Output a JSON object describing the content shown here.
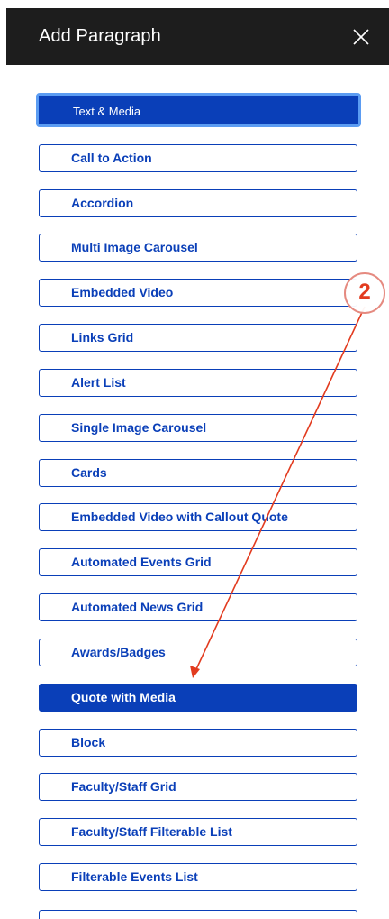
{
  "dialog": {
    "title": "Add Paragraph",
    "close_icon": "close-icon"
  },
  "paragraph_types": [
    {
      "label": "Text & Media",
      "state": "focused"
    },
    {
      "label": "Call to Action",
      "state": "default"
    },
    {
      "label": "Accordion",
      "state": "default"
    },
    {
      "label": "Multi Image Carousel",
      "state": "default"
    },
    {
      "label": "Embedded Video",
      "state": "default"
    },
    {
      "label": "Links Grid",
      "state": "default"
    },
    {
      "label": "Alert List",
      "state": "default"
    },
    {
      "label": "Single Image Carousel",
      "state": "default"
    },
    {
      "label": "Cards",
      "state": "default"
    },
    {
      "label": "Embedded Video with Callout Quote",
      "state": "default"
    },
    {
      "label": "Automated Events Grid",
      "state": "default"
    },
    {
      "label": "Automated News Grid",
      "state": "default"
    },
    {
      "label": "Awards/Badges",
      "state": "default"
    },
    {
      "label": "Quote with Media",
      "state": "active"
    },
    {
      "label": "Block",
      "state": "default"
    },
    {
      "label": "Faculty/Staff Grid",
      "state": "default"
    },
    {
      "label": "Faculty/Staff Filterable List",
      "state": "default"
    },
    {
      "label": "Filterable Events List",
      "state": "default"
    }
  ],
  "annotation": {
    "step_number": "2",
    "color": "#e23b1f"
  },
  "colors": {
    "header_bg": "#1d1d1d",
    "brand_blue": "#0a3fb8",
    "focus_ring": "#5b9cf2"
  }
}
